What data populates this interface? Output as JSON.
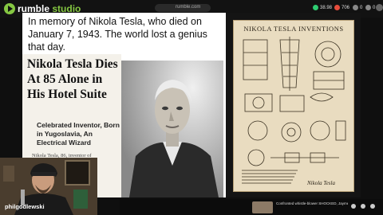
{
  "app": {
    "brand": "rumble",
    "brand_suffix": "studio",
    "url": "rumble.com"
  },
  "stats": [
    {
      "value": "38.98",
      "color": "#2ecc71"
    },
    {
      "value": "706",
      "color": "#e74c3c"
    },
    {
      "value": "0",
      "color": "#888888"
    },
    {
      "value": "0",
      "color": "#888888"
    }
  ],
  "slide": {
    "caption": "In memory of Nikola Tesla, who died on January 7, 1943. The world lost a genius that day.",
    "clipping": {
      "headline": "Nikola Tesla Dies At 85 Alone in His Hotel Suite",
      "subhead": "Celebrated Inventor, Born in Yugoslavia, An Electrical Wizard",
      "body": "Nikola Tesla, 86, inventor of"
    },
    "poster": {
      "title": "NIKOLA TESLA INVENTIONS",
      "signature": "Nikola Tesla"
    }
  },
  "host": {
    "username": "philgodlewski"
  },
  "recommended": {
    "title": "Confronted whistle-blower SHOCKED, Jayme Jongsma ..."
  },
  "colors": {
    "accent": "#85c742",
    "background": "#0f0f0f"
  }
}
